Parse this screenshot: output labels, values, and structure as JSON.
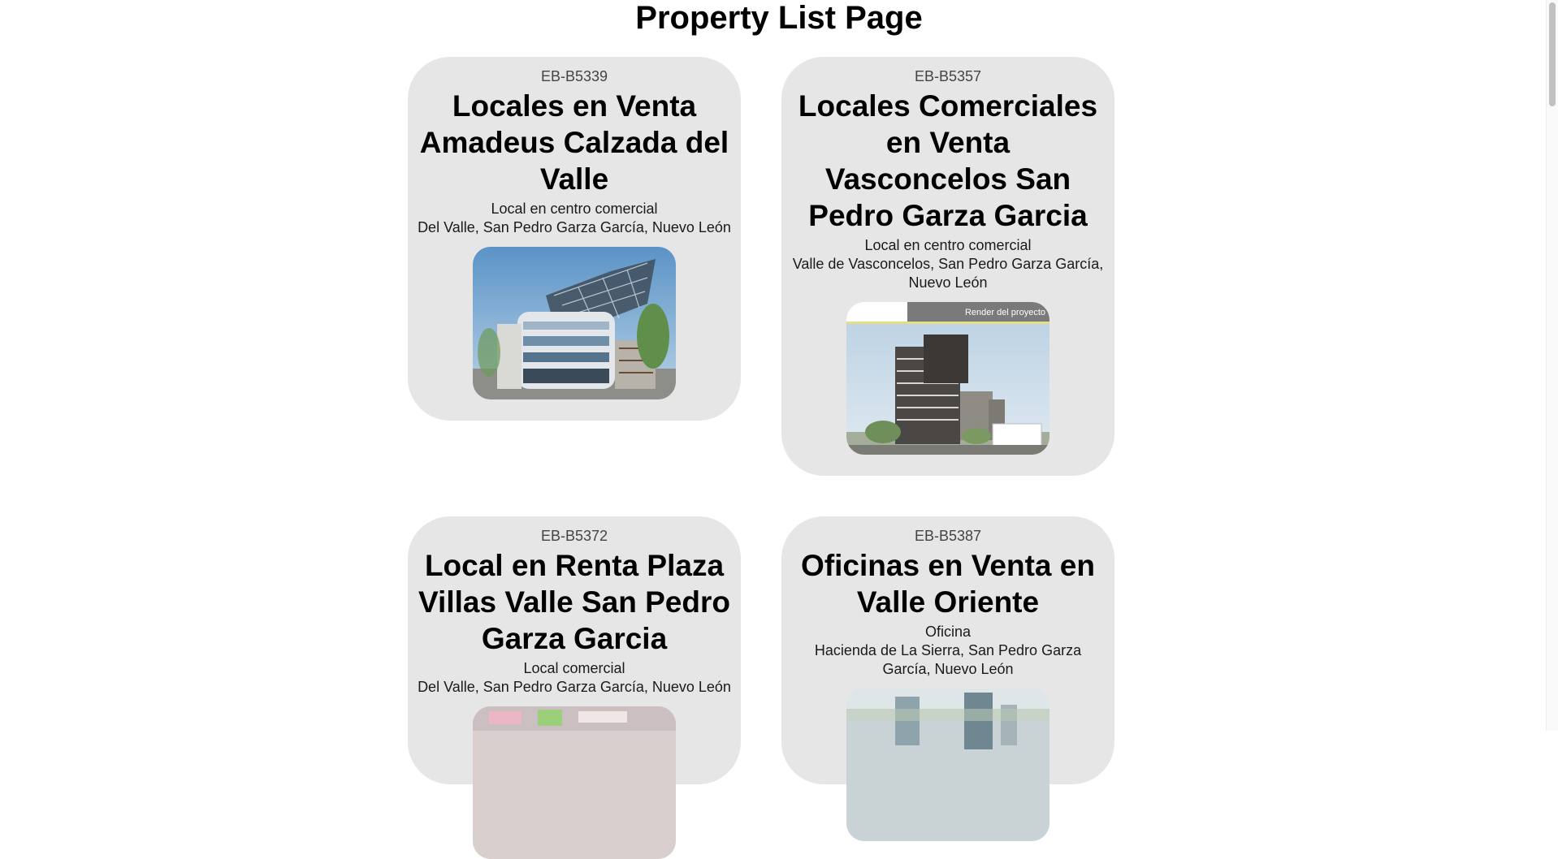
{
  "page": {
    "title": "Property List Page"
  },
  "properties": [
    {
      "code": "EB-B5339",
      "title": "Locales en Venta Amadeus Calzada del Valle",
      "type": "Local en centro comercial",
      "location": "Del Valle, San Pedro Garza García, Nuevo León"
    },
    {
      "code": "EB-B5357",
      "title": "Locales Comerciales en Venta Vasconcelos San Pedro Garza Garcia",
      "type": "Local en centro comercial",
      "location": "Valle de Vasconcelos, San Pedro Garza García, Nuevo León",
      "image_caption": "Render del proyecto"
    },
    {
      "code": "EB-B5372",
      "title": "Local en Renta Plaza Villas Valle San Pedro Garza Garcia",
      "type": "Local comercial",
      "location": "Del Valle, San Pedro Garza García, Nuevo León"
    },
    {
      "code": "EB-B5387",
      "title": "Oficinas en Venta en Valle Oriente",
      "type": "Oficina",
      "location": "Hacienda de La Sierra, San Pedro Garza García, Nuevo León"
    }
  ]
}
